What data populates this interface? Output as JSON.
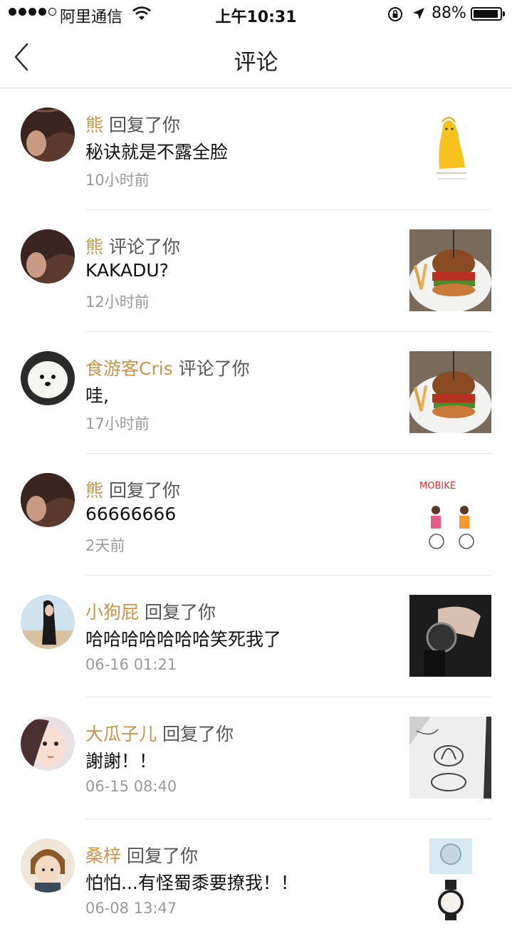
{
  "status_bar": {
    "carrier": "阿里通信",
    "time": "上午10:31",
    "battery": "88%"
  },
  "nav": {
    "title": "评论"
  },
  "comments": [
    {
      "user": "熊",
      "action": "回复了你",
      "text": "秘诀就是不露全脸",
      "time": "10小时前"
    },
    {
      "user": "熊",
      "action": "评论了你",
      "text": "KAKADU?",
      "time": "12小时前"
    },
    {
      "user": "食游客Cris",
      "action": "评论了你",
      "text": "哇,",
      "time": "17小时前"
    },
    {
      "user": "熊",
      "action": "回复了你",
      "text": "66666666",
      "time": "2天前"
    },
    {
      "user": "小狗屁",
      "action": "回复了你",
      "text": "哈哈哈哈哈哈哈笑死我了",
      "time": "06-16 01:21"
    },
    {
      "user": "大瓜子儿",
      "action": "回复了你",
      "text": "謝謝！！",
      "time": "06-15 08:40"
    },
    {
      "user": "桑梓",
      "action": "回复了你",
      "text": "怕怕...有怪蜀黍要撩我！！",
      "time": "06-08 13:47"
    }
  ],
  "thumbnails": {
    "bike_sticker_text": "MOBIKE"
  },
  "colors": {
    "username": "#c3964f",
    "action": "#555555",
    "time": "#9a9a9a",
    "divider": "#e2e2e2"
  }
}
